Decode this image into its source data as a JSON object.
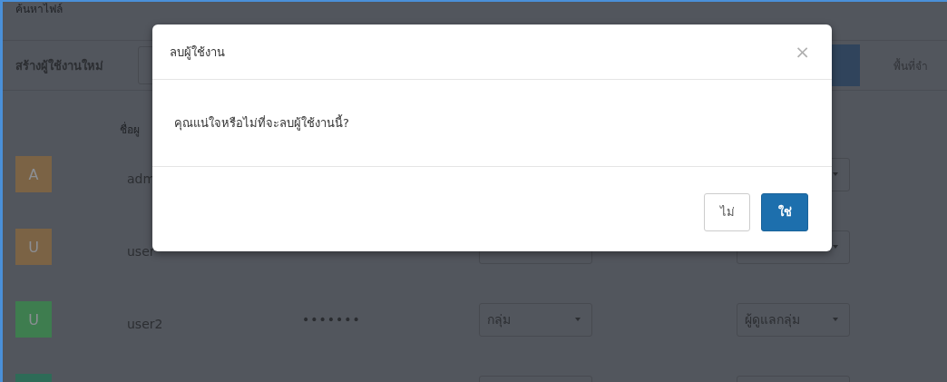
{
  "page": {
    "search_label": "ค้นหาไฟล์",
    "create_label": "สร้างผู้ใช้งานใหม่",
    "storage_label": "พื้นที่จำ",
    "column_header": "ชื่อผู"
  },
  "users": [
    {
      "initial": "A",
      "color": "#7b6345",
      "name": "adm"
    },
    {
      "initial": "U",
      "color": "#7b6345",
      "name": "user"
    },
    {
      "initial": "U",
      "color": "#3e7d4f",
      "name": "user2",
      "password": "•••••••",
      "group": "กลุ่ม",
      "role": "ผู้ดูแลกลุ่ม"
    },
    {
      "color": "#2e6b57"
    }
  ],
  "dialog": {
    "title": "ลบผู้ใช้งาน",
    "close": "×",
    "message": "คุณแน่ใจหรือไม่ที่จะลบผู้ใช้งานนี้?",
    "buttons": [
      {
        "label": "ไม่",
        "kind": "secondary"
      },
      {
        "label": "ใช่",
        "kind": "primary"
      }
    ]
  }
}
